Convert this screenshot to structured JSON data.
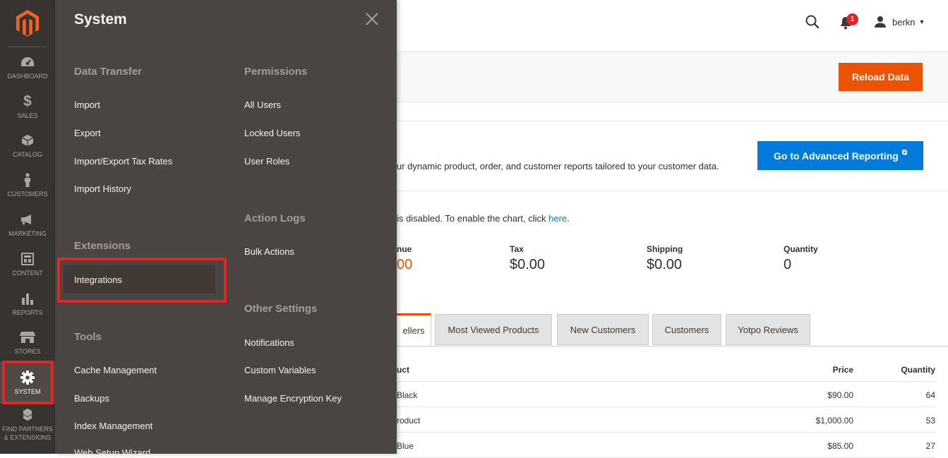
{
  "sidebar": {
    "items": [
      {
        "name": "dashboard",
        "label": "DASHBOARD"
      },
      {
        "name": "sales",
        "label": "SALES"
      },
      {
        "name": "catalog",
        "label": "CATALOG"
      },
      {
        "name": "customers",
        "label": "CUSTOMERS"
      },
      {
        "name": "marketing",
        "label": "MARKETING"
      },
      {
        "name": "content",
        "label": "CONTENT"
      },
      {
        "name": "reports",
        "label": "REPORTS"
      },
      {
        "name": "stores",
        "label": "STORES"
      },
      {
        "name": "system",
        "label": "SYSTEM",
        "active": true
      },
      {
        "name": "find-partners",
        "label": "FIND PARTNERS\n& EXTENSIONS"
      }
    ]
  },
  "flyout": {
    "title": "System",
    "sections": {
      "data_transfer": {
        "title": "Data Transfer",
        "links": [
          "Import",
          "Export",
          "Import/Export Tax Rates",
          "Import History"
        ]
      },
      "extensions": {
        "title": "Extensions",
        "links": [
          "Integrations"
        ]
      },
      "tools": {
        "title": "Tools",
        "links": [
          "Cache Management",
          "Backups",
          "Index Management",
          "Web Setup Wizard"
        ]
      },
      "permissions": {
        "title": "Permissions",
        "links": [
          "All Users",
          "Locked Users",
          "User Roles"
        ]
      },
      "action_logs": {
        "title": "Action Logs",
        "links": [
          "Bulk Actions"
        ]
      },
      "other_settings": {
        "title": "Other Settings",
        "links": [
          "Notifications",
          "Custom Variables",
          "Manage Encryption Key"
        ]
      }
    }
  },
  "header": {
    "notification_count": "1",
    "username": "berkn"
  },
  "toolbar": {
    "reload_label": "Reload Data"
  },
  "advanced_reporting": {
    "text": "ur dynamic product, order, and customer reports tailored to your customer data.",
    "button_label": "Go to Advanced Reporting"
  },
  "chart_notice": {
    "text": "is disabled. To enable the chart, click ",
    "link": "here",
    "tail": "."
  },
  "stats": [
    {
      "label": "nue",
      "value": "00"
    },
    {
      "label": "Tax",
      "value": "$0.00"
    },
    {
      "label": "Shipping",
      "value": "$0.00"
    },
    {
      "label": "Quantity",
      "value": "0"
    }
  ],
  "tabs": [
    "ellers",
    "Most Viewed Products",
    "New Customers",
    "Customers",
    "Yotpo Reviews"
  ],
  "grid": {
    "headers": [
      "uct",
      "Price",
      "Quantity"
    ],
    "rows": [
      [
        "Black",
        "$90.00",
        "64"
      ],
      [
        "roduct",
        "$1,000.00",
        "53"
      ],
      [
        "Blue",
        "$85.00",
        "27"
      ]
    ]
  },
  "colors": {
    "accent": "#eb5202",
    "link": "#007bdb",
    "highlight": "#e22626",
    "nav_bg": "#373330",
    "flyout_bg": "#4a4542"
  }
}
